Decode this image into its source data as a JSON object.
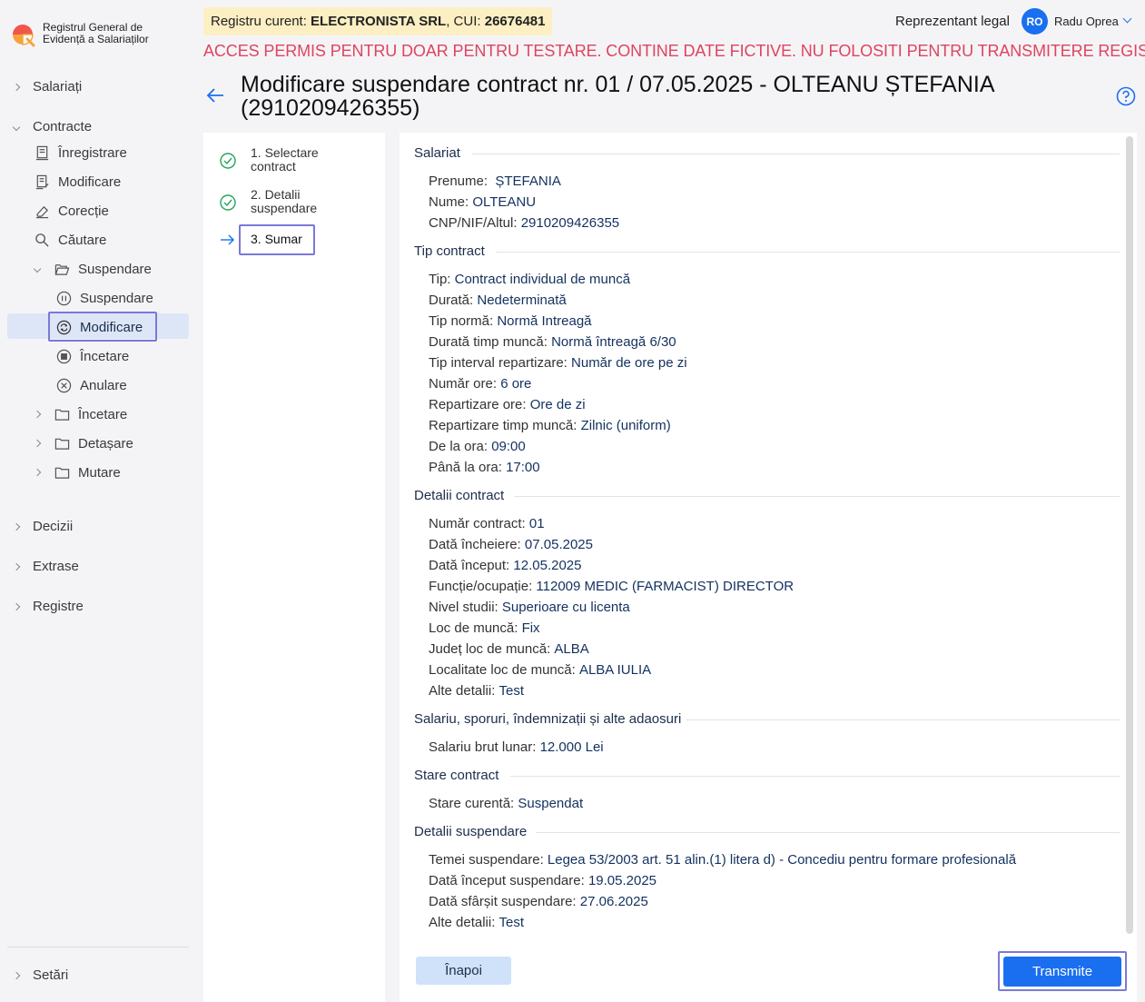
{
  "app": {
    "name_line1": "Registrul General de",
    "name_line2": "Evidență a Salariaților"
  },
  "sidebar": {
    "salariati": "Salariați",
    "contracte": "Contracte",
    "inregistrare": "Înregistrare",
    "modificare": "Modificare",
    "corectie": "Corecție",
    "cautare": "Căutare",
    "suspendare_folder": "Suspendare",
    "suspendare": "Suspendare",
    "modificare_active": "Modificare",
    "incetare_sub": "Încetare",
    "anulare": "Anulare",
    "incetare_folder": "Încetare",
    "detasare": "Detașare",
    "mutare": "Mutare",
    "decizii": "Decizii",
    "extrase": "Extrase",
    "registre": "Registre",
    "setari": "Setări"
  },
  "topbar": {
    "registry_prefix": "Registru curent: ",
    "registry_company": "ELECTRONISTA SRL",
    "registry_cui_label": ", CUI: ",
    "registry_cui": "26676481",
    "role": "Reprezentant legal",
    "avatar_initials": "RO",
    "user_name": "Radu Oprea",
    "warning": "ACCES PERMIS PENTRU DOAR PENTRU TESTARE. CONTINE DATE FICTIVE. NU FOLOSITI PENTRU TRANSMITERE REGISTRU"
  },
  "page": {
    "title": "Modificare suspendare contract nr. 01 / 07.05.2025 - OLTEANU  ȘTEFANIA (2910209426355)"
  },
  "steps": [
    {
      "label_line1": "1. Selectare",
      "label_line2": "contract"
    },
    {
      "label_line1": "2. Detalii",
      "label_line2": "suspendare"
    },
    {
      "label_line1": "3. Sumar"
    }
  ],
  "summary": {
    "salariat": {
      "heading": "Salariat",
      "prenume_label": "Prenume: ",
      "prenume": " ȘTEFANIA",
      "nume_label": "Nume: ",
      "nume": "OLTEANU",
      "cnp_label": "CNP/NIF/Altul: ",
      "cnp": "2910209426355"
    },
    "tip_contract": {
      "heading": "Tip contract",
      "rows": [
        {
          "label": "Tip: ",
          "value": "Contract individual de muncă"
        },
        {
          "label": "Durată: ",
          "value": "Nedeterminată"
        },
        {
          "label": "Tip normă: ",
          "value": "Normă Intreagă"
        },
        {
          "label": "Durată timp muncă: ",
          "value": "Normă întreagă 6/30"
        },
        {
          "label": "Tip interval repartizare: ",
          "value": "Număr de ore pe zi"
        },
        {
          "label": "Număr ore: ",
          "value": "6 ore"
        },
        {
          "label": "Repartizare ore: ",
          "value": "Ore de zi"
        },
        {
          "label": "Repartizare timp muncă: ",
          "value": "Zilnic (uniform)"
        },
        {
          "label": "De la ora: ",
          "value": "09:00"
        },
        {
          "label": "Până la ora: ",
          "value": "17:00"
        }
      ]
    },
    "detalii_contract": {
      "heading": "Detalii contract",
      "rows": [
        {
          "label": "Număr contract: ",
          "value": "01"
        },
        {
          "label": "Dată încheiere: ",
          "value": "07.05.2025"
        },
        {
          "label": "Dată început: ",
          "value": "12.05.2025"
        },
        {
          "label": "Funcție/ocupație: ",
          "value": "112009 MEDIC (FARMACIST) DIRECTOR"
        },
        {
          "label": "Nivel studii: ",
          "value": "Superioare cu licenta"
        },
        {
          "label": "Loc de muncă: ",
          "value": "Fix"
        },
        {
          "label": "Județ loc de muncă: ",
          "value": "ALBA"
        },
        {
          "label": "Localitate loc de muncă: ",
          "value": "ALBA IULIA"
        },
        {
          "label": "Alte detalii: ",
          "value": "Test"
        }
      ]
    },
    "salariu": {
      "heading": "Salariu, sporuri, îndemnizații și alte adaosuri",
      "rows": [
        {
          "label": "Salariu brut lunar: ",
          "value": "12.000 Lei"
        }
      ]
    },
    "stare": {
      "heading": "Stare contract",
      "rows": [
        {
          "label": "Stare curentă: ",
          "value": "Suspendat"
        }
      ]
    },
    "suspendare": {
      "heading": "Detalii suspendare",
      "rows": [
        {
          "label": "Temei suspendare: ",
          "value": "Legea 53/2003 art. 51 alin.(1) litera d) - Concediu pentru formare profesională"
        },
        {
          "label": "Dată început suspendare: ",
          "value": "19.05.2025"
        },
        {
          "label": "Dată sfârșit suspendare: ",
          "value": "27.06.2025"
        },
        {
          "label": "Alte detalii: ",
          "value": "Test"
        }
      ]
    }
  },
  "buttons": {
    "back": "Înapoi",
    "submit": "Transmite"
  },
  "colors": {
    "primary": "#1a6ff0",
    "warning": "#e0435f",
    "registry_bg": "#fcefc3",
    "selection": "#7a79d8"
  }
}
